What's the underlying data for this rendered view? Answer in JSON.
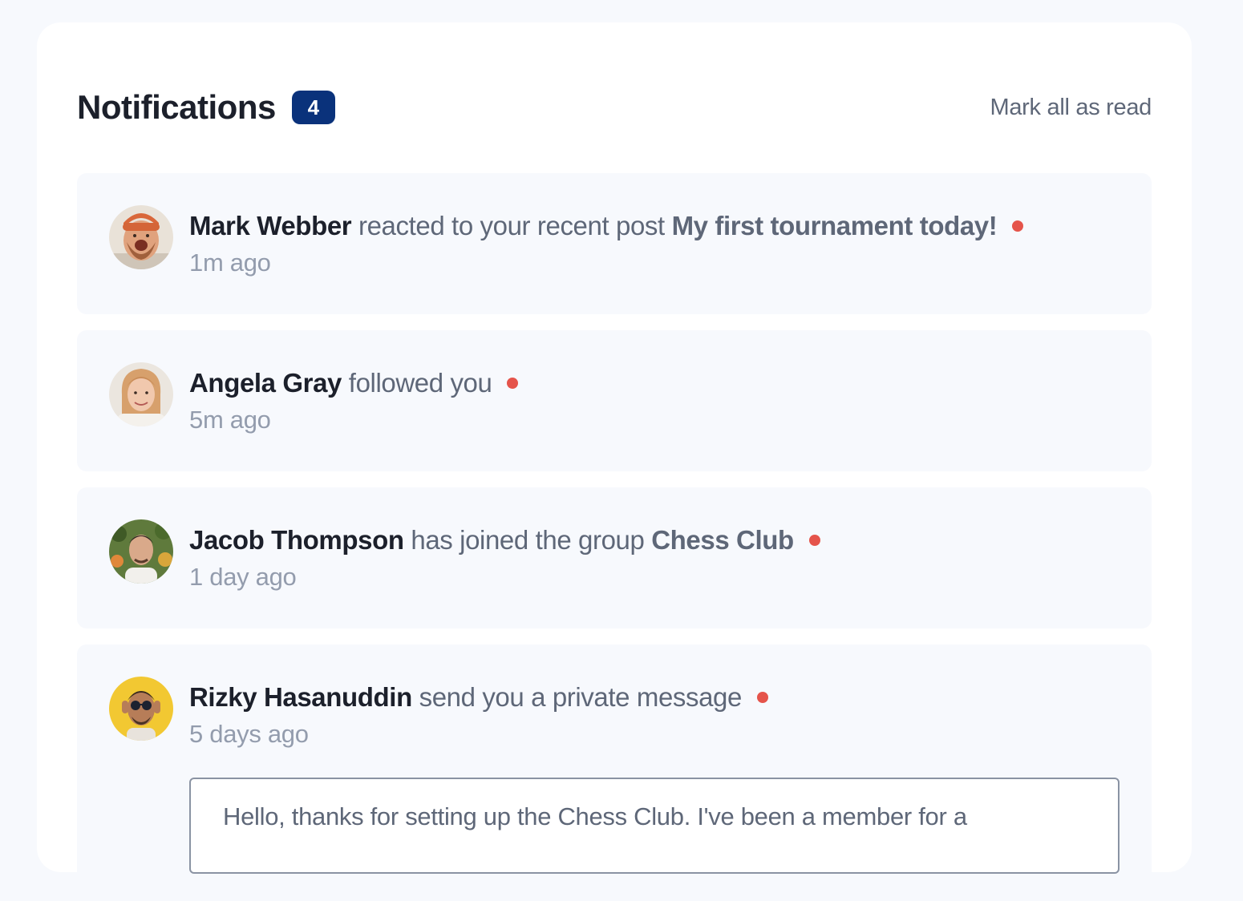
{
  "header": {
    "title": "Notifications",
    "unread_count": "4",
    "mark_all_label": "Mark all as read"
  },
  "notifications": [
    {
      "name": "Mark Webber",
      "action": "reacted to your recent post",
      "target": "My first tournament today!",
      "time": "1m ago",
      "unread": true
    },
    {
      "name": "Angela Gray",
      "action": "followed you",
      "target": "",
      "time": "5m ago",
      "unread": true
    },
    {
      "name": "Jacob Thompson",
      "action": "has joined the group",
      "target": "Chess Club",
      "time": "1 day ago",
      "unread": true
    },
    {
      "name": "Rizky Hasanuddin",
      "action": "send you a private message",
      "target": "",
      "time": "5 days ago",
      "unread": true,
      "message": "Hello, thanks for setting up the Chess Club. I've been a member for a"
    }
  ],
  "colors": {
    "badge": "#0a327b",
    "unread_dot": "#e5544b",
    "page_bg": "#f7f9fd",
    "heading": "#1c202b",
    "body_text": "#5e6778",
    "muted": "#939cad"
  }
}
